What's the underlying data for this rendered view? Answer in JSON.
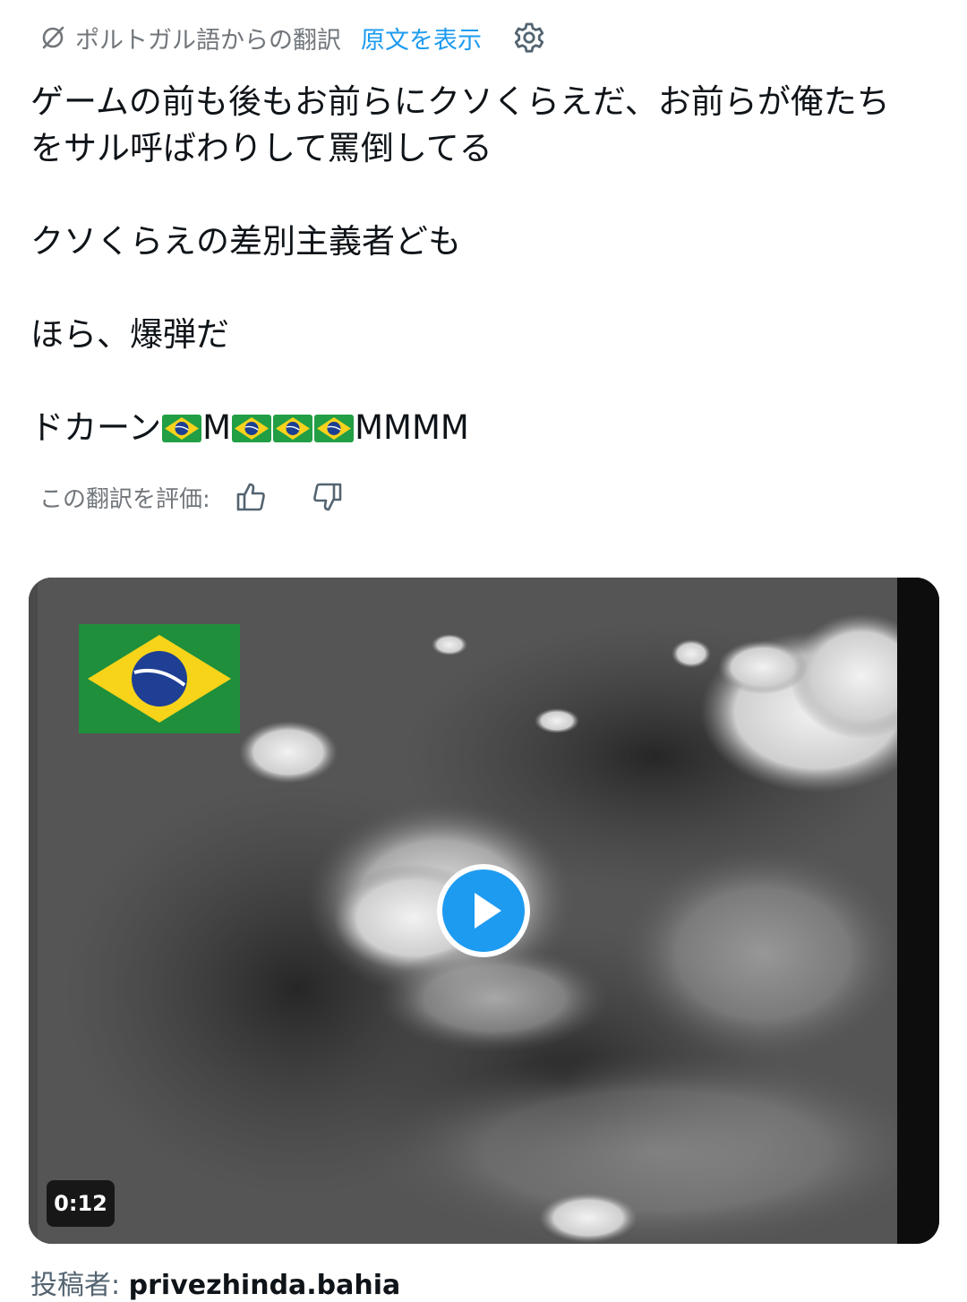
{
  "translation_bar": {
    "label": "ポルトガル語からの翻訳",
    "show_original": "原文を表示"
  },
  "tweet": {
    "lines": [
      "ゲームの前も後もお前らにクソくらえだ、お前らが俺たち",
      "をサル呼ばわりして罵倒してる",
      "クソくらえの差別主義者ども",
      "ほら、爆弾だ"
    ],
    "last_line": {
      "prefix": "ドカーン",
      "m1": "M",
      "m2": "MMMM",
      "emoji": "Brazil flag"
    }
  },
  "rating": {
    "label": "この翻訳を評価:"
  },
  "video": {
    "duration": "0:12"
  },
  "poster": {
    "label": "投稿者:",
    "name": "privezhinda.bahia"
  },
  "colors": {
    "accent": "#1d9bf0",
    "muted": "#71767b"
  },
  "icons": [
    "translate-slash-icon",
    "gear-icon",
    "thumbs-up-icon",
    "thumbs-down-icon",
    "play-icon",
    "brazil-flag-icon"
  ]
}
